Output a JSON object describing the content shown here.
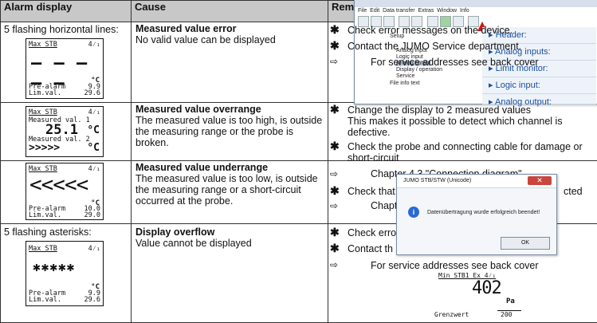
{
  "headers": {
    "display": "Alarm display",
    "cause": "Cause",
    "remedy": "Remedy"
  },
  "rows": [
    {
      "display_text": "5 flashing horizontal lines:",
      "lcd": {
        "top": "Max  STB",
        "top_right": "4⁄₁",
        "main": "– – – – –",
        "unit": "°C",
        "l1": "Pre-alarm",
        "v1": "9.9",
        "l2": "Lim.val.",
        "v2": "29.6"
      },
      "cause_title": "Measured value error",
      "cause_text": "No valid value can be displayed",
      "remedy": [
        {
          "mark": "✱",
          "text": "Check error messages on the device."
        },
        {
          "mark": "✱",
          "text": "Contact the JUMO Service department."
        },
        {
          "mark": "⇨",
          "text": "For service addresses see back cover"
        }
      ]
    },
    {
      "lcd": {
        "top": "Max  STB",
        "top_right": "4⁄₁",
        "l1": "Measured val.",
        "i1": "1",
        "v1": "25.1",
        "u1": "°C",
        "l2": "Measured val.",
        "i2": "2",
        "v2": ">>>>>",
        "u2": "°C"
      },
      "cause_title": "Measured value overrange",
      "cause_text": "The measured value is too high, is outside the measuring range or the probe is broken.",
      "remedy": [
        {
          "mark": "✱",
          "text": "Change the display to 2 measured values"
        },
        {
          "mark": "",
          "text": "This makes it possible to detect which channel is defective."
        },
        {
          "mark": "✱",
          "text": "Check the probe and connecting cable for damage or short-circuit"
        },
        {
          "mark": "⇨",
          "text": "Chapter 4.3 \"Connection diagram\""
        }
      ]
    },
    {
      "lcd": {
        "top": "Max  STB",
        "top_right": "4⁄₁",
        "main": "<<<<<",
        "unit": "°C",
        "l1": "Pre-alarm",
        "v1": "10.0",
        "l2": "Lim.val.",
        "v2": "29.0"
      },
      "cause_title": "Measured value underrange",
      "cause_text": "The measured value is too low, is outside the measuring range or a short-circuit occurred at the probe.",
      "remedy": [
        {
          "mark": "✱",
          "text": "Check that"
        },
        {
          "mark": "",
          "text": "cted"
        },
        {
          "mark": "⇨",
          "text": "Chapte"
        }
      ]
    },
    {
      "display_text": "5 flashing asterisks:",
      "lcd": {
        "top": "Max  STB",
        "top_right": "4⁄₁",
        "main": "✱✱✱✱✱",
        "unit": "°C",
        "l1": "Pre-alarm",
        "v1": "9.9",
        "l2": "Lim.val.",
        "v2": "29.6"
      },
      "cause_title": "Display overflow",
      "cause_text": "Value cannot be displayed",
      "remedy": [
        {
          "mark": "✱",
          "text": "Check erro"
        },
        {
          "mark": "✱",
          "text": "Contact th"
        },
        {
          "mark": "⇨",
          "text": "For service addresses see back cover"
        }
      ]
    }
  ],
  "software_window": {
    "menu": [
      "File",
      "Edit",
      "Data transfer",
      "Extras",
      "Window",
      "Info"
    ],
    "tree": [
      "Setup",
      "Analog input",
      "Logic input",
      "Analog output",
      "Display / operation",
      "Service",
      "File info text"
    ],
    "links": [
      "Header:",
      "Analog inputs:",
      "Limit monitor:",
      "Logic input:",
      "Analog output:"
    ]
  },
  "dialog": {
    "title": "JUMO STB/STW (Unicode)",
    "message": "Datenübertragung wurde erfolgreich beendet!",
    "ok_label": "OK"
  },
  "lcd_big": {
    "top": "Min  STB1  Ex  4⁄₁",
    "value": "402",
    "unit": "Pa",
    "label": "Grenzwert",
    "limit": "200"
  }
}
